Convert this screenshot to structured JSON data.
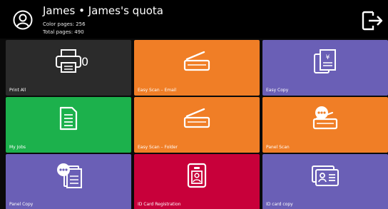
{
  "header": {
    "user_name": "James",
    "separator": "•",
    "quota_name": "James's quota",
    "color_pages_label": "Color pages: 256",
    "total_pages_label": "Total pages: 490",
    "avatar_icon": "user-avatar-icon",
    "logout_icon": "logout-icon"
  },
  "colors": {
    "dark": "#2b2b2b",
    "orange": "#f07e26",
    "purple": "#6a5fb6",
    "green": "#1cb14c",
    "crimson": "#c8003a"
  },
  "tiles": [
    {
      "label": "Print All",
      "icon": "printer-icon",
      "count": "0",
      "color": "#2b2b2b"
    },
    {
      "label": "Easy Scan – Email",
      "icon": "scanner-icon",
      "color": "#f07e26"
    },
    {
      "label": "Easy Copy",
      "icon": "copy-icon",
      "color": "#6a5fb6"
    },
    {
      "label": "My Jobs",
      "icon": "document-icon",
      "color": "#1cb14c"
    },
    {
      "label": "Easy Scan – Folder",
      "icon": "scanner-icon",
      "color": "#f07e26"
    },
    {
      "label": "Panel Scan",
      "icon": "panel-scan-icon",
      "color": "#f07e26"
    },
    {
      "label": "Panel Copy",
      "icon": "panel-copy-icon",
      "color": "#6a5fb6"
    },
    {
      "label": "ID Card Registration",
      "icon": "id-badge-icon",
      "color": "#c8003a"
    },
    {
      "label": "ID card copy",
      "icon": "id-card-icon",
      "color": "#6a5fb6"
    }
  ]
}
